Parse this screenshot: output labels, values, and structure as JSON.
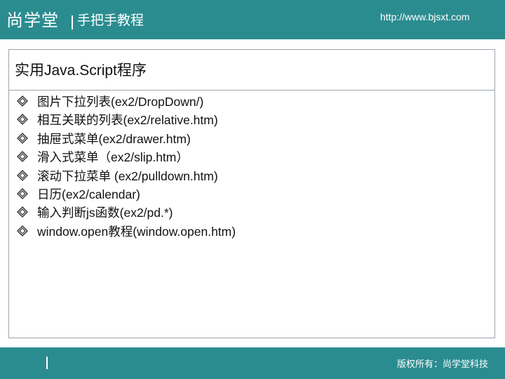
{
  "header": {
    "brand": "尚学堂",
    "tagline": "手把手教程",
    "url": "http://www.bjsxt.com"
  },
  "slide": {
    "title_cn_prefix": "实用",
    "title_en": "Java.Script",
    "title_cn_suffix": "程序",
    "items": [
      "图片下拉列表(ex2/DropDown/)",
      "相互关联的列表(ex2/relative.htm)",
      "抽屉式菜单(ex2/drawer.htm)",
      "滑入式菜单（ex2/slip.htm）",
      "滚动下拉菜单 (ex2/pulldown.htm)",
      "日历(ex2/calendar)",
      "输入判断js函数(ex2/pd.*)",
      "window.open教程(window.open.htm)"
    ]
  },
  "footer": {
    "copyright": "版权所有：尚学堂科技"
  },
  "colors": {
    "bar": "#2b8c90",
    "text": "#111111",
    "border": "#9aa4ae"
  },
  "icons": {
    "bullet": "diamond-bullet-icon"
  }
}
